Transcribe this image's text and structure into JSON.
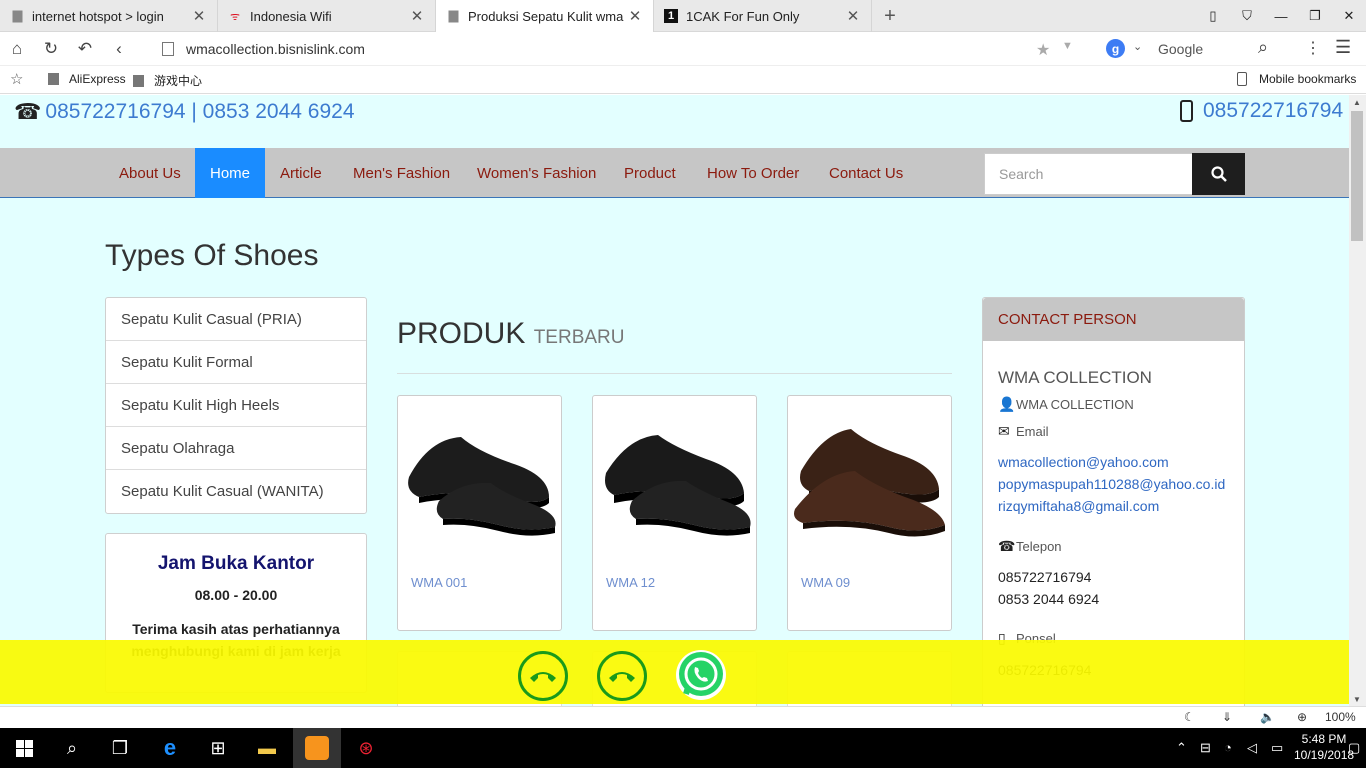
{
  "browser": {
    "tabs": [
      {
        "label": "internet hotspot > login",
        "icon": "document-icon"
      },
      {
        "label": "Indonesia Wifi",
        "icon": "wifi-icon"
      },
      {
        "label": "Produksi Sepatu Kulit wma co",
        "icon": "document-icon"
      },
      {
        "label": "1CAK For Fun Only",
        "icon": "1cak-icon"
      }
    ],
    "url": "wmacollection.bisnislink.com",
    "search_engine": "Google",
    "search_engine_letter": "g",
    "bookmarks": [
      {
        "label": "AliExpress"
      },
      {
        "label": "游戏中心"
      }
    ],
    "mobile_bookmarks": "Mobile bookmarks",
    "zoom": "100%"
  },
  "site": {
    "phone_left": "085722716794 | 0853 2044 6924",
    "phone_right": "085722716794",
    "nav": [
      {
        "label": "About Us"
      },
      {
        "label": "Home"
      },
      {
        "label": "Article"
      },
      {
        "label": "Men's Fashion"
      },
      {
        "label": "Women's Fashion"
      },
      {
        "label": "Product"
      },
      {
        "label": "How To Order"
      },
      {
        "label": "Contact Us"
      }
    ],
    "nav_active": "Home",
    "search_placeholder": "Search",
    "section_title": "Types Of Shoes",
    "categories": [
      {
        "label": "Sepatu Kulit Casual (PRIA)"
      },
      {
        "label": "Sepatu Kulit Formal"
      },
      {
        "label": "Sepatu Kulit High Heels"
      },
      {
        "label": "Sepatu Olahraga"
      },
      {
        "label": "Sepatu Kulit Casual (WANITA)"
      }
    ],
    "hours": {
      "title": "Jam Buka Kantor",
      "time": "08.00 - 20.00",
      "note": "Terima kasih atas perhatiannya menghubungi kami di jam kerja"
    },
    "products_heading": "PRODUK",
    "products_heading_small": "TERBARU",
    "products": [
      {
        "name": "WMA 001",
        "color": "#1a1a1a"
      },
      {
        "name": "WMA 12",
        "color": "#1a1a1a"
      },
      {
        "name": "WMA 09",
        "color": "#4a2a1c"
      }
    ],
    "contact": {
      "header": "CONTACT PERSON",
      "company": "WMA COLLECTION",
      "person": "WMA COLLECTION",
      "email_label": "Email",
      "emails": [
        "wmacollection@yahoo.com",
        "popymaspupah110288@yahoo.co.id",
        "rizqymiftaha8@gmail.com"
      ],
      "phone_label": "Telepon",
      "phones": [
        "085722716794",
        "0853 2044 6924"
      ],
      "mobile_label": "Ponsel",
      "mobile": "085722716794"
    }
  },
  "taskbar": {
    "time": "5:48 PM",
    "date": "10/19/2018"
  },
  "colors": {
    "page_bg": "#e3ffff",
    "nav_bg": "#c6c6c6",
    "nav_active": "#1a8cff",
    "nav_text": "#8b1a0e",
    "callbar": "#fafa00",
    "call_green": "#1a9a1a"
  }
}
